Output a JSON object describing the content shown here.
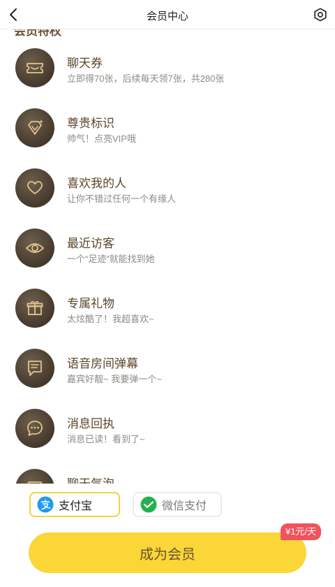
{
  "header": {
    "title": "会员中心"
  },
  "section": {
    "title": "会员特权"
  },
  "privileges": [
    {
      "name": "聊天券",
      "desc": "立即得70张，后续每天领7张，共280张",
      "icon": "ticket-icon"
    },
    {
      "name": "尊贵标识",
      "desc": "帅气！点亮VIP哦",
      "icon": "diamond-icon"
    },
    {
      "name": "喜欢我的人",
      "desc": "让你不错过任何一个有缘人",
      "icon": "heart-icon"
    },
    {
      "name": "最近访客",
      "desc": "一个“足迹”就能找到她",
      "icon": "eye-icon"
    },
    {
      "name": "专属礼物",
      "desc": "太炫酷了！我超喜欢~",
      "icon": "gift-icon"
    },
    {
      "name": "语音房间弹幕",
      "desc": "嘉宾好靓~ 我要弹一个~",
      "icon": "danmaku-icon"
    },
    {
      "name": "消息回执",
      "desc": "消息已读！看到了~",
      "icon": "message-receipt-icon"
    },
    {
      "name": "聊天气泡",
      "desc": "",
      "icon": "chat-bubble-icon"
    }
  ],
  "payment": {
    "alipay_label": "支付宝",
    "wechat_label": "微信支付",
    "selected": "alipay"
  },
  "cta": {
    "label": "成为会员",
    "price_tag": "¥1元/天"
  },
  "colors": {
    "accent_yellow": "#fad637",
    "icon_circle": "#45392c",
    "icon_line": "#e4c48f",
    "price_tag": "#f2525c"
  }
}
